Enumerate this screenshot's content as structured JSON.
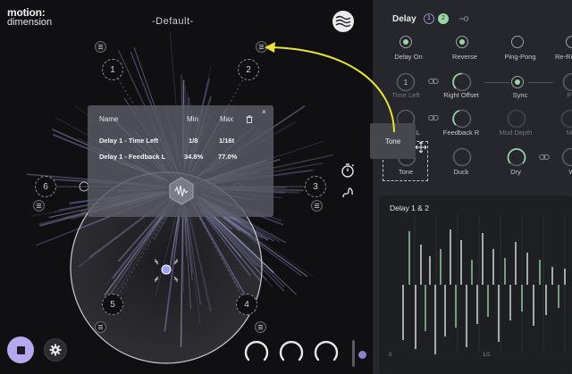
{
  "app": {
    "logo_line1": "motion:",
    "logo_line2": "dimension",
    "preset_name": "-Default-"
  },
  "nodes": [
    {
      "label": "1"
    },
    {
      "label": "2"
    },
    {
      "label": "3"
    },
    {
      "label": "4"
    },
    {
      "label": "5"
    },
    {
      "label": "6"
    }
  ],
  "mod_popup": {
    "headers": {
      "name": "Name",
      "min": "Min",
      "max": "Max"
    },
    "close_glyph": "×",
    "rows": [
      {
        "name": "Delay 1 - Time Left",
        "min": "1/8",
        "max": "1/16t"
      },
      {
        "name": "Delay 1 - Feedback L",
        "min": "34.8%",
        "max": "77.0%"
      }
    ]
  },
  "delay": {
    "title": "Delay",
    "tab1": "1",
    "tab2": "2",
    "toggles": [
      {
        "label": "Delay On",
        "on": true
      },
      {
        "label": "Reverse",
        "on": true
      },
      {
        "label": "Ping-Pong",
        "on": false
      },
      {
        "label": "Re-Ri",
        "on": false
      }
    ],
    "knobs_row2": [
      {
        "label": "Time Left",
        "value": "1"
      },
      {
        "label": "Right Offset",
        "value": ""
      },
      {
        "label": "Sync",
        "value": ""
      },
      {
        "label": "P",
        "value": ""
      }
    ],
    "knobs_row3": [
      {
        "label": "k L"
      },
      {
        "label": "Feedback R"
      },
      {
        "label": "Mod Depth"
      },
      {
        "label": "Mod"
      }
    ],
    "knobs_row4": [
      {
        "label": "Tone"
      },
      {
        "label": "Duck"
      },
      {
        "label": "Dry"
      },
      {
        "label": "W"
      }
    ],
    "drag_tooltip": "Tone"
  },
  "graph": {
    "title": "Delay 1 & 2",
    "axis_start": "0",
    "axis_mid": "1/2"
  },
  "colors": {
    "accent_purple": "#b6a8ee",
    "accent_green": "#9ad6a6",
    "arrow_yellow": "#e8e23a"
  }
}
